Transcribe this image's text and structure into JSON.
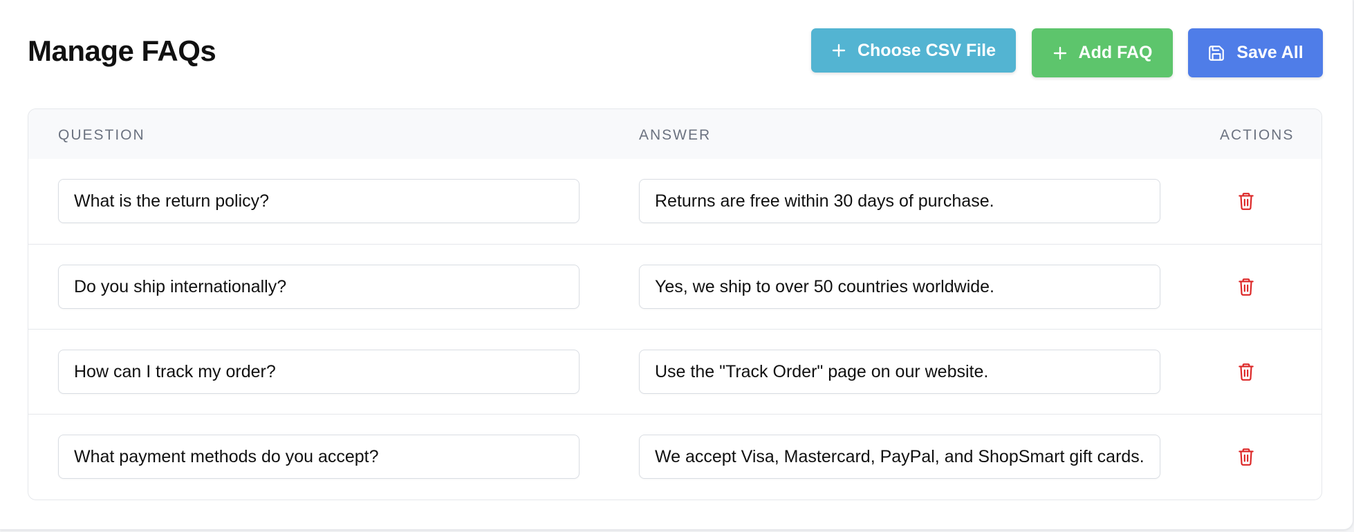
{
  "page": {
    "title": "Manage FAQs"
  },
  "toolbar": {
    "choose_csv_label": "Choose CSV File",
    "add_faq_label": "Add FAQ",
    "save_all_label": "Save All",
    "colors": {
      "choose_csv": "#53b4d2",
      "add_faq": "#5dc56c",
      "save_all": "#4f7de8"
    },
    "icons": {
      "choose_csv": "plus-icon",
      "add_faq": "plus-icon",
      "save_all": "save-icon"
    }
  },
  "table": {
    "columns": [
      "QUESTION",
      "ANSWER",
      "ACTIONS"
    ],
    "rows": [
      {
        "question": "What is the return policy?",
        "answer": "Returns are free within 30 days of purchase."
      },
      {
        "question": "Do you ship internationally?",
        "answer": "Yes, we ship to over 50 countries worldwide."
      },
      {
        "question": "How can I track my order?",
        "answer": "Use the \"Track Order\" page on our website."
      },
      {
        "question": "What payment methods do you accept?",
        "answer": "We accept Visa, Mastercard, PayPal, and ShopSmart gift cards."
      }
    ],
    "row_action_icon": "trash-icon",
    "delete_color": "#dc2626"
  }
}
